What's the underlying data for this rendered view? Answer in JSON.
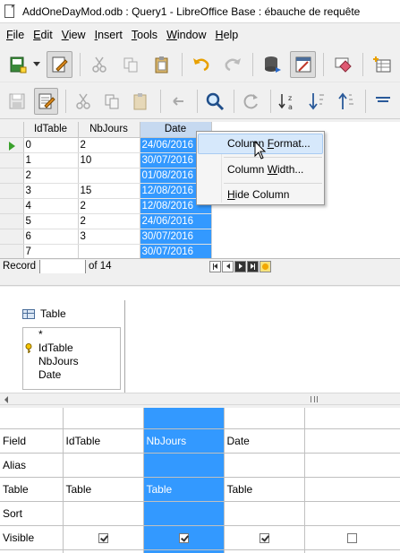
{
  "window": {
    "title": "AddOneDayMod.odb : Query1 - LibreOffice Base : ébauche de requête"
  },
  "menubar": {
    "items": [
      {
        "pre": "",
        "key": "F",
        "post": "ile"
      },
      {
        "pre": "",
        "key": "E",
        "post": "dit"
      },
      {
        "pre": "",
        "key": "V",
        "post": "iew"
      },
      {
        "pre": "",
        "key": "I",
        "post": "nsert"
      },
      {
        "pre": "",
        "key": "T",
        "post": "ools"
      },
      {
        "pre": "",
        "key": "W",
        "post": "indow"
      },
      {
        "pre": "",
        "key": "H",
        "post": "elp"
      }
    ]
  },
  "toolbar1": {
    "buttons": [
      "new-document",
      "edit-file",
      "cut",
      "copy",
      "paste",
      "undo",
      "redo",
      "run-query",
      "design-view-toggle",
      "clear-query",
      "add-table"
    ]
  },
  "toolbar2": {
    "buttons": [
      "save",
      "edit-data",
      "cut",
      "copy",
      "paste",
      "undo",
      "find",
      "refresh",
      "sort-descending",
      "sort-ascending",
      "sort-up",
      "filter"
    ]
  },
  "result_grid": {
    "columns": [
      "IdTable",
      "NbJours",
      "Date"
    ],
    "selected_column": "Date",
    "current_row_index": 0,
    "rows": [
      {
        "id": "0",
        "nb": "2",
        "date": "24/06/2016"
      },
      {
        "id": "1",
        "nb": "10",
        "date": "30/07/2016"
      },
      {
        "id": "2",
        "nb": "",
        "date": "01/08/2016"
      },
      {
        "id": "3",
        "nb": "15",
        "date": "12/08/2016"
      },
      {
        "id": "4",
        "nb": "2",
        "date": "12/08/2016"
      },
      {
        "id": "5",
        "nb": "2",
        "date": "24/06/2016"
      },
      {
        "id": "6",
        "nb": "3",
        "date": "30/07/2016"
      },
      {
        "id": "7",
        "nb": "",
        "date": "30/07/2016"
      }
    ]
  },
  "navigator": {
    "record_label": "Record",
    "record_value": "",
    "of_text": "of 14"
  },
  "context_menu": {
    "items": [
      {
        "pre": "Column ",
        "key": "F",
        "post": "ormat..."
      },
      {
        "pre": "Column ",
        "key": "W",
        "post": "idth..."
      },
      {
        "pre": "",
        "key": "H",
        "post": "ide Column"
      }
    ]
  },
  "table_window": {
    "title": "Table",
    "fields": [
      "*",
      "IdTable",
      "NbJours",
      "Date"
    ],
    "primary_key": "IdTable"
  },
  "criteria": {
    "row_labels": [
      "Field",
      "Alias",
      "Table",
      "Sort",
      "Visible"
    ],
    "columns": [
      {
        "field": "IdTable",
        "alias": "",
        "table": "Table",
        "sort": "",
        "visible": true
      },
      {
        "field": "NbJours",
        "alias": "",
        "table": "Table",
        "sort": "",
        "visible": true
      },
      {
        "field": "Date",
        "alias": "",
        "table": "Table",
        "sort": "",
        "visible": true
      },
      {
        "field": "",
        "alias": "",
        "table": "",
        "sort": "",
        "visible": false
      }
    ]
  },
  "colors": {
    "selection": "#3399ff",
    "menu_hover": "#d6e8fb"
  }
}
